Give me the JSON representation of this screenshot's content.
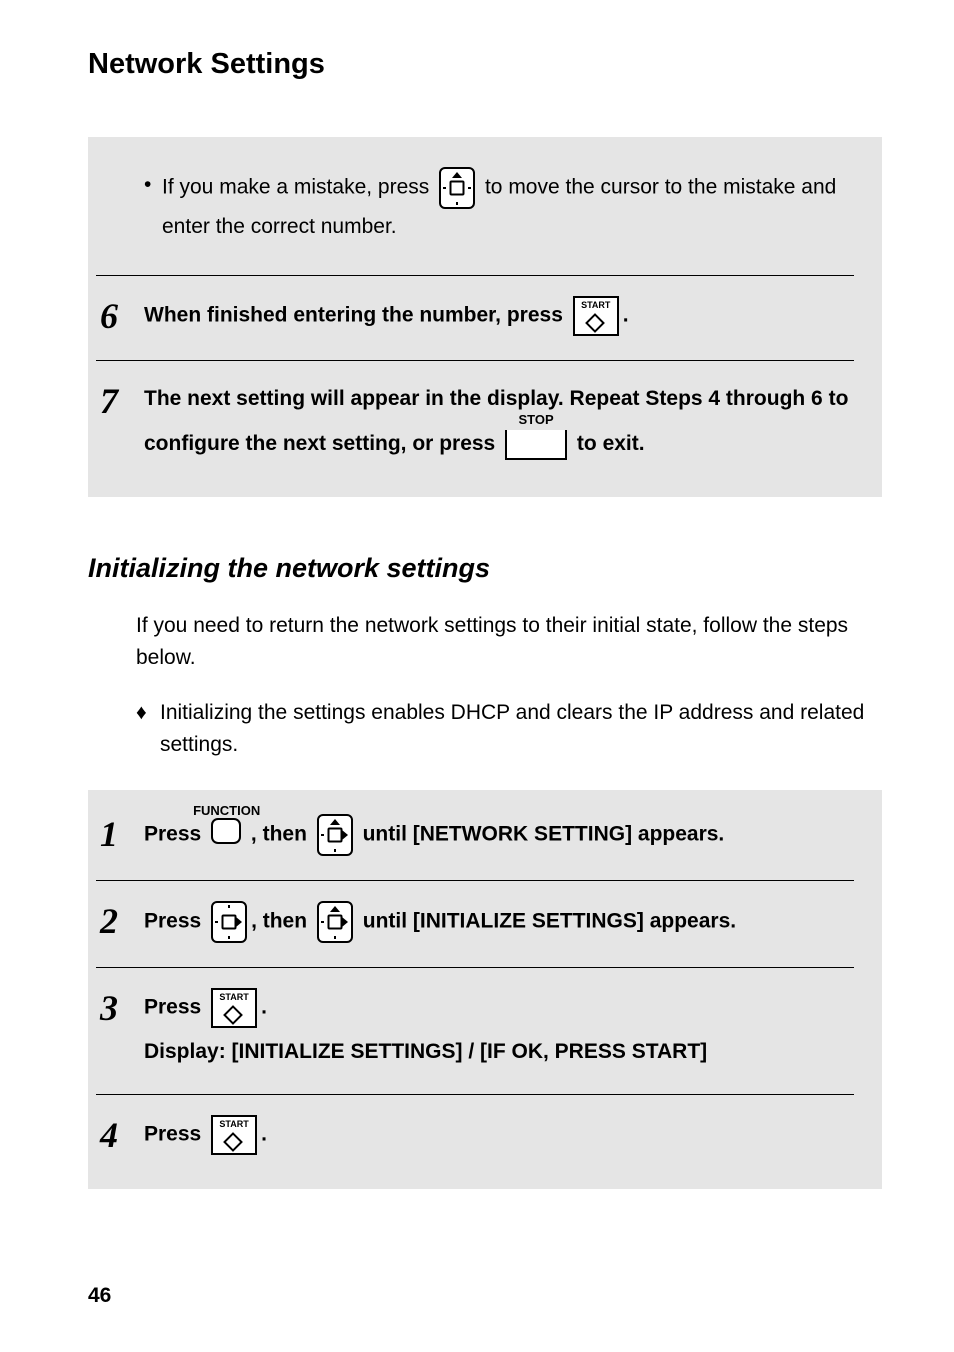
{
  "page_title": "Network Settings",
  "block1": {
    "bullet5": "If you make a mistake, press",
    "bullet5_after": "to move the cursor to the mistake and enter the correct number.",
    "step6_num": "6",
    "step6_text_before": "When finished entering the number, press",
    "step6_text_after": ".",
    "step7_num": "7",
    "step7_line1": "The next setting will appear in the display. Repeat Steps 4 through 6 to",
    "step7_before_stop": "configure the next setting, or press",
    "step7_after_stop": "to exit.",
    "start_label": "START",
    "stop_label": "STOP"
  },
  "section2": {
    "title": "Initializing the network settings",
    "intro": "If you need to return the network settings to their initial state, follow the steps below.",
    "bullet": "Initializing the settings enables DHCP and clears the IP address and related settings."
  },
  "block2": {
    "step1_num": "1",
    "step1_a": "Press",
    "step1_b": ", then",
    "step1_c": "until [NETWORK SETTING] appears.",
    "func_label": "FUNCTION",
    "step2_num": "2",
    "step2_a": "Press",
    "step2_b": ", then",
    "step2_c": "until [INITIALIZE SETTINGS] appears.",
    "step3_num": "3",
    "step3_a": "Press",
    "step3_b": ".",
    "step3_line2": "Display: [INITIALIZE SETTINGS] / [IF OK, PRESS START]",
    "step4_num": "4",
    "step4_a": "Press",
    "step4_b": ".",
    "start_label": "START"
  },
  "page_number": "46"
}
